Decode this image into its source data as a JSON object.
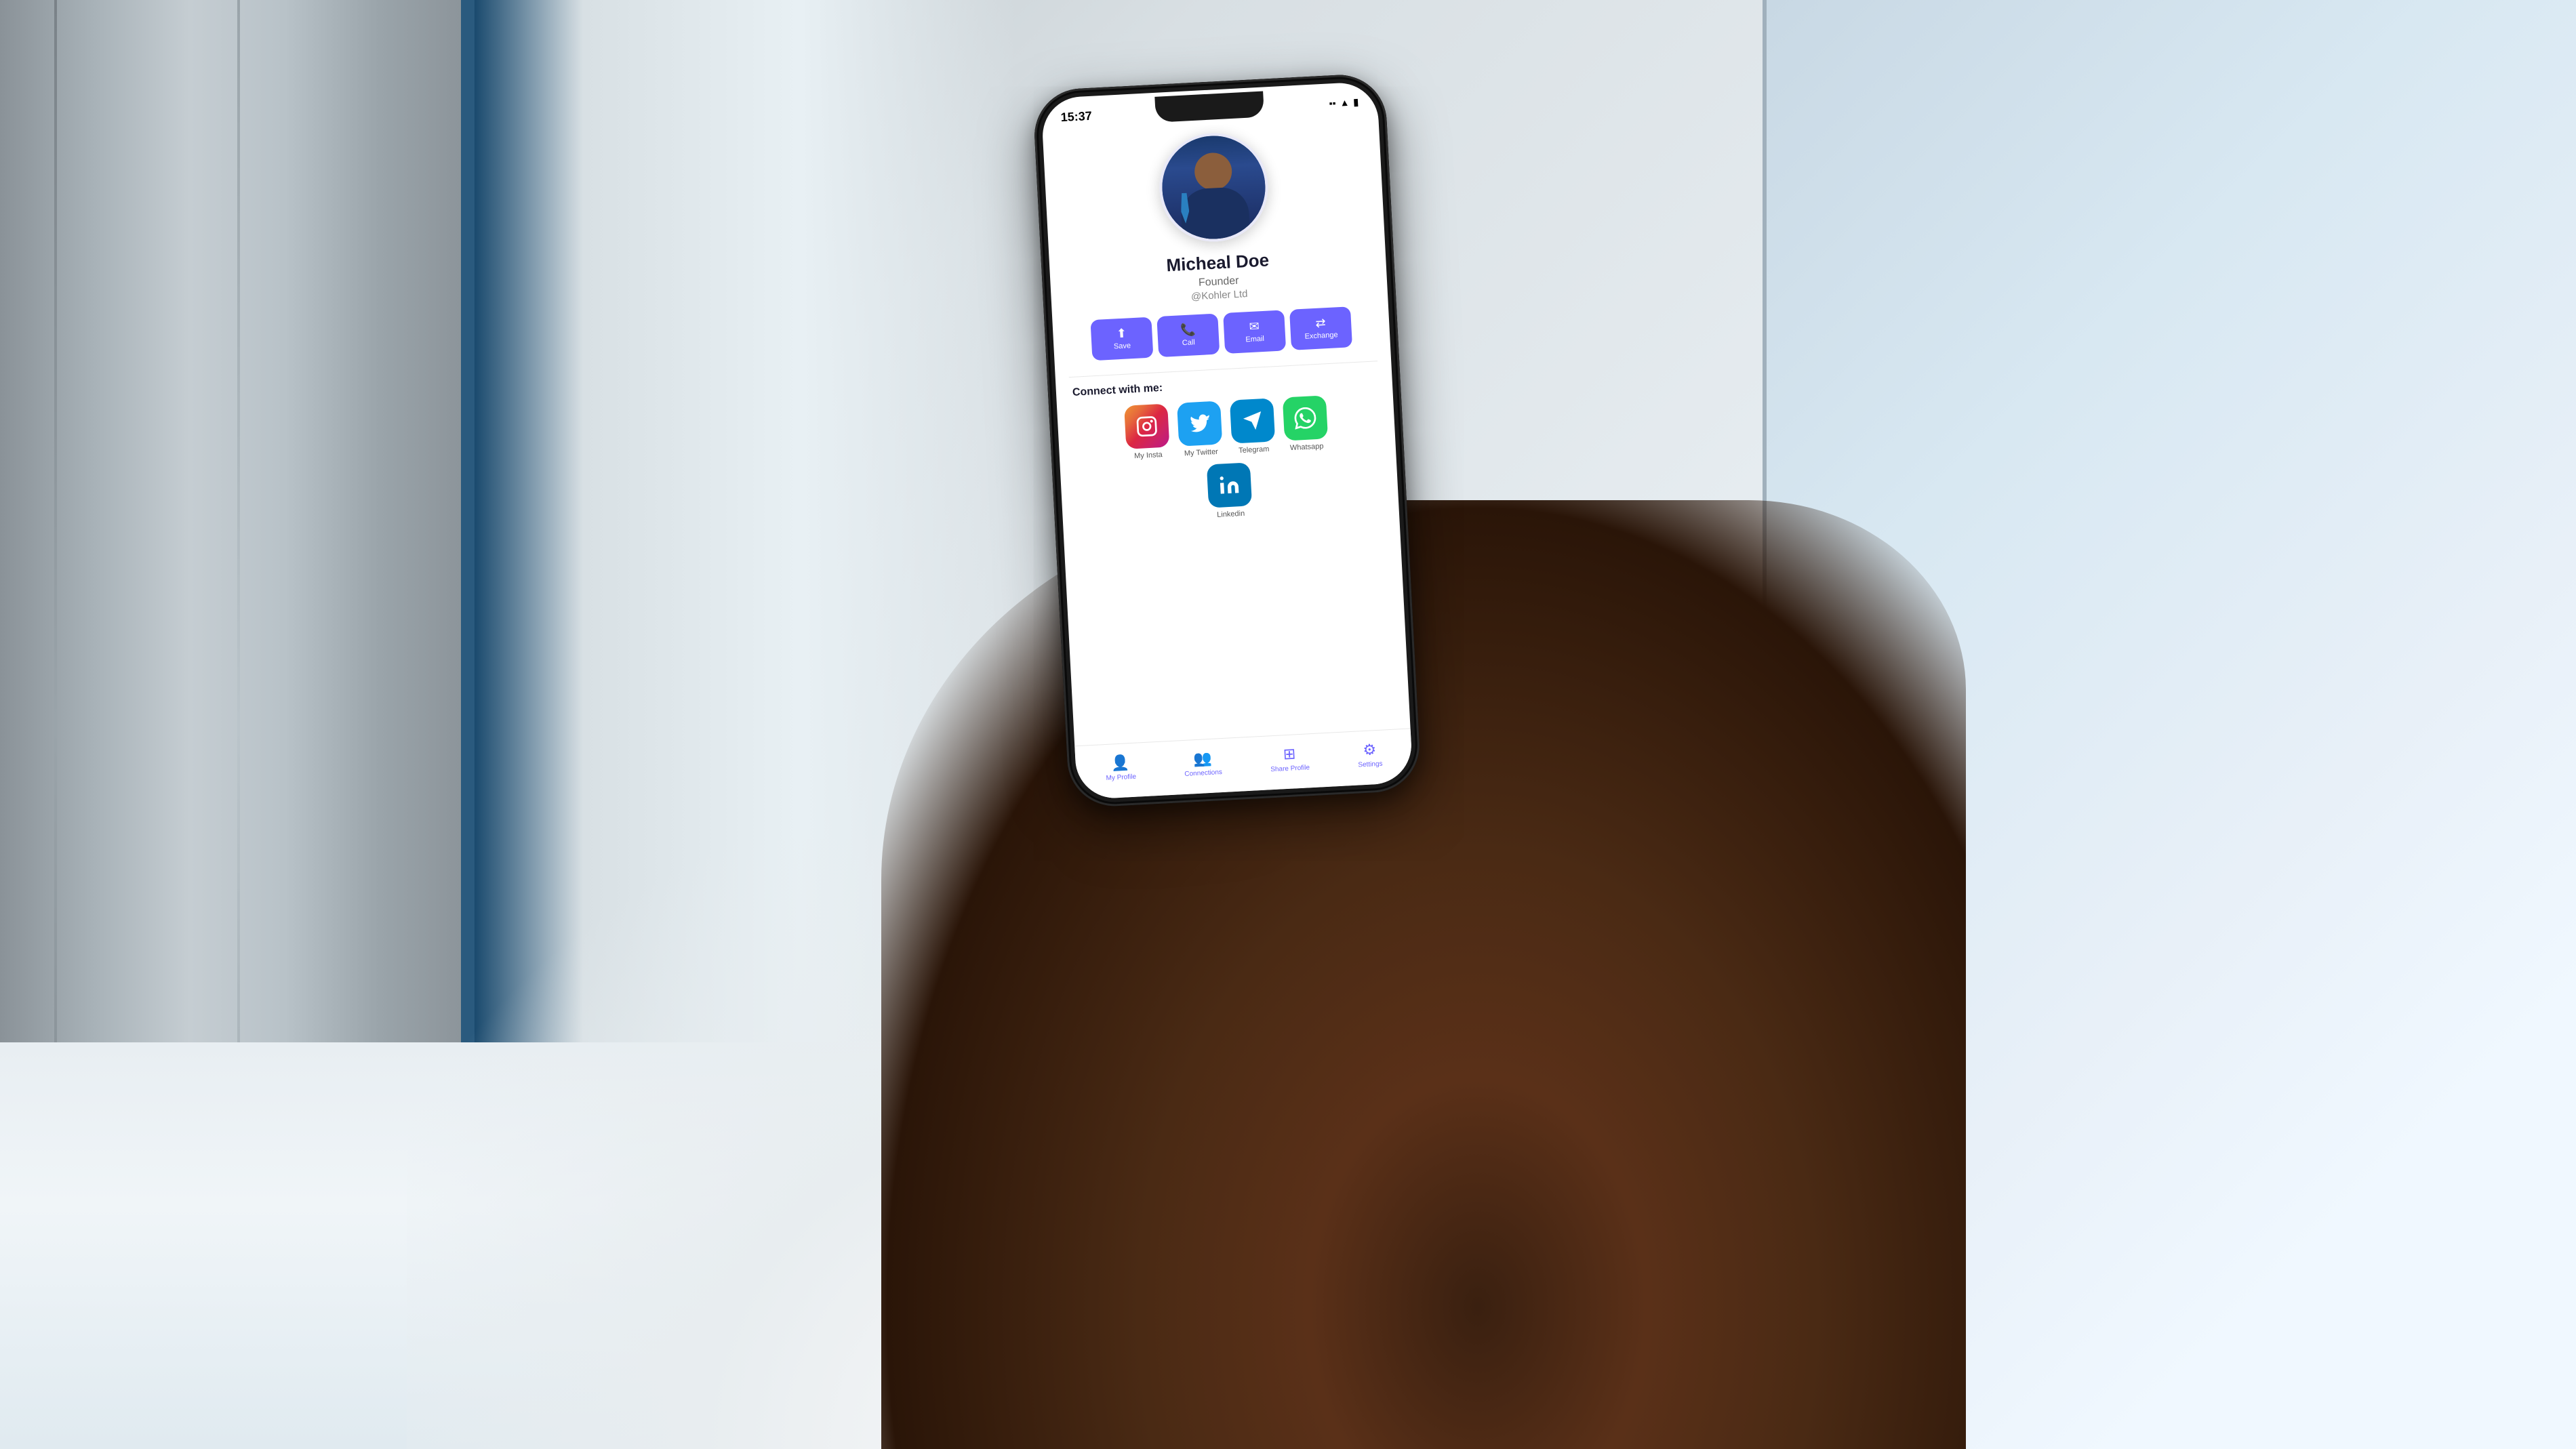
{
  "background": {
    "description": "Office hallway with elevator on left, tiled floor, windows on right"
  },
  "phone": {
    "status_bar": {
      "time": "15:37",
      "icons": "●● ▲ 🔋"
    },
    "profile": {
      "name": "Micheal Doe",
      "title": "Founder",
      "company": "@Kohler Ltd",
      "avatar_alt": "Professional headshot of a man in a blue suit"
    },
    "action_buttons": [
      {
        "icon": "⬆",
        "label": "Save"
      },
      {
        "icon": "📞",
        "label": "Call"
      },
      {
        "icon": "✉",
        "label": "Email"
      },
      {
        "icon": "⇄",
        "label": "Exchange"
      }
    ],
    "connect_section": {
      "label": "Connect with me:",
      "social_links": [
        {
          "name": "instagram",
          "label": "My Insta",
          "color": "instagram"
        },
        {
          "name": "twitter",
          "label": "My Twitter",
          "color": "twitter"
        },
        {
          "name": "telegram",
          "label": "Telegram",
          "color": "telegram"
        },
        {
          "name": "whatsapp",
          "label": "Whatsapp",
          "color": "whatsapp"
        },
        {
          "name": "linkedin",
          "label": "Linkedin",
          "color": "linkedin"
        }
      ]
    },
    "bottom_nav": [
      {
        "icon": "👤",
        "label": "My Profile"
      },
      {
        "icon": "👥",
        "label": "Connections"
      },
      {
        "icon": "⊞",
        "label": "Share Profile"
      },
      {
        "icon": "⚙",
        "label": "Settings"
      }
    ]
  }
}
